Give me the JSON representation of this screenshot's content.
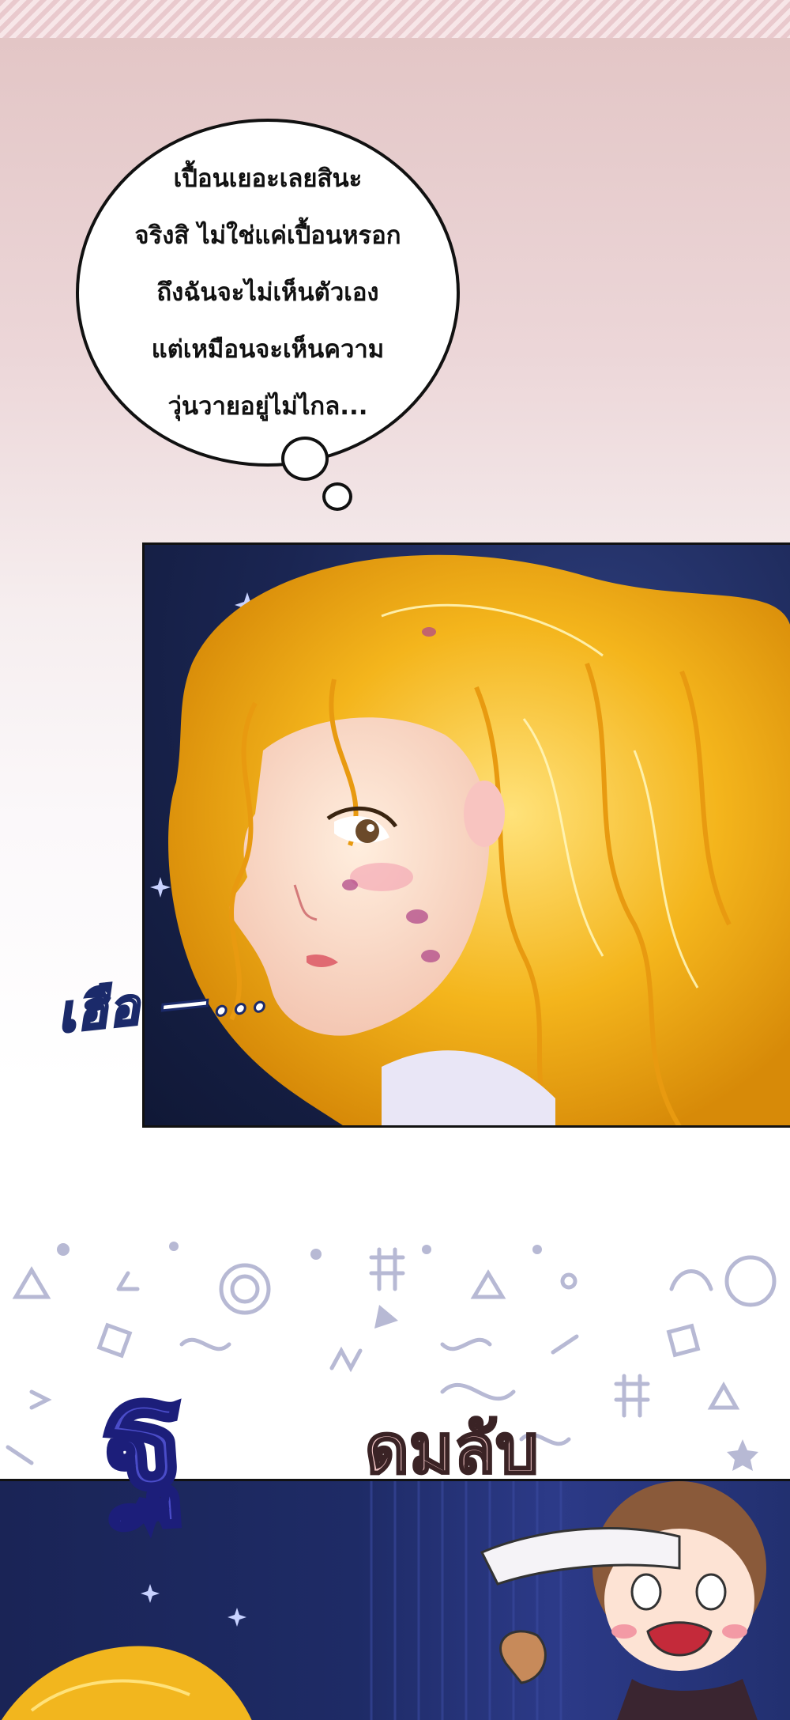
{
  "speech_bubble": {
    "lines": [
      "เปื้อนเยอะเลยสินะ",
      "จริงสิ ไม่ใช่แค่เปื้อนหรอก",
      "ถึงฉันจะไม่เห็นตัวเอง",
      "แต่เหมือนจะเห็นความ",
      "วุ่นวายอยู่ไม่ไกล..."
    ]
  },
  "panel1": {
    "sound_effect": "เฮือ —..."
  },
  "panel2": {
    "sound_effect_large": "ฐ",
    "sound_effect_small": "ดมลับ"
  },
  "colors": {
    "night_sky": "#1a2552",
    "hair_gold": "#f2b61e",
    "bubble_outline": "#111111",
    "sfx_blue": "#4a4cc8",
    "sfx_pink": "#f2c5c5"
  }
}
